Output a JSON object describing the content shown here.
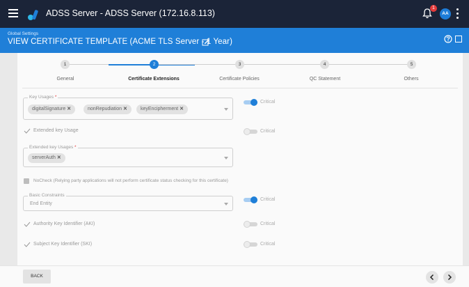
{
  "app": {
    "title": "ADSS Server - ADSS Server (172.16.8.113)",
    "notification_count": "1",
    "avatar_initials": "AA"
  },
  "header": {
    "breadcrumb": "Global Settings",
    "title": "VIEW CERTIFICATE TEMPLATE (ACME TLS Server - 1 Year)"
  },
  "stepper": {
    "steps": [
      {
        "number": "1",
        "label": "General"
      },
      {
        "number": "2",
        "label": "Certificate Extensions"
      },
      {
        "number": "3",
        "label": "Certificate Policies"
      },
      {
        "number": "4",
        "label": "QC Statement"
      },
      {
        "number": "5",
        "label": "Others"
      }
    ],
    "active_step": 2
  },
  "form": {
    "key_usages": {
      "label": "Key Usages",
      "required": "*",
      "chips": [
        "digitalSignature",
        "nonRepudiation",
        "keyEncipherment"
      ],
      "critical_label": "Critical",
      "critical_on": true
    },
    "extended_key_usage": {
      "label": "Extended key Usage",
      "checked": true,
      "critical_label": "Critical",
      "critical_on": false
    },
    "extended_key_usages": {
      "label": "Extended key Usages",
      "required": "*",
      "chips": [
        "serverAuth"
      ]
    },
    "nocheck": {
      "label": "NoCheck (Relying party applications will not perform certificate status checking for this certificate)",
      "checked": false
    },
    "basic_constraints": {
      "label": "Basic Constraints",
      "value": "End Entity",
      "critical_label": "Critical",
      "critical_on": true
    },
    "aki": {
      "label": "Authority Key Identifier (AKI)",
      "checked": true,
      "critical_label": "Critical",
      "critical_on": false
    },
    "ski": {
      "label": "Subject Key Identifier (SKI)",
      "checked": true,
      "critical_label": "Critical",
      "critical_on": false
    }
  },
  "footer": {
    "back_label": "BACK"
  },
  "colors": {
    "topbar": "#1b2438",
    "header": "#1f7fd8",
    "accent": "#1f7fd8"
  }
}
